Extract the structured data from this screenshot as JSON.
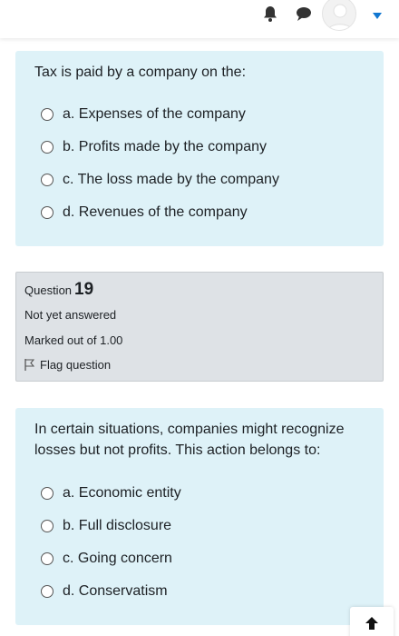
{
  "topbar": {
    "icons": [
      "bell-icon",
      "chat-icon",
      "user-avatar",
      "chevron-down-icon"
    ],
    "accent_color": "#1177d1"
  },
  "question_18": {
    "text": "Tax is paid by a company on the:",
    "answers": [
      "a. Expenses of the company",
      "b. Profits made by the company",
      "c. The loss made by the company",
      "d. Revenues of the company"
    ]
  },
  "question_19_info": {
    "label": "Question",
    "number": "19",
    "state": "Not yet answered",
    "grade": "Marked out of 1.00",
    "flag_label": "Flag question"
  },
  "question_19": {
    "text": "In certain situations, companies might recognize losses but not profits. This action belongs to:",
    "answers": [
      "a. Economic entity",
      "b. Full disclosure",
      "c. Going concern",
      "d. Conservatism"
    ]
  },
  "colors": {
    "question_bg": "#def2f8",
    "info_bg": "#dee2e6",
    "text": "#1d2125"
  }
}
